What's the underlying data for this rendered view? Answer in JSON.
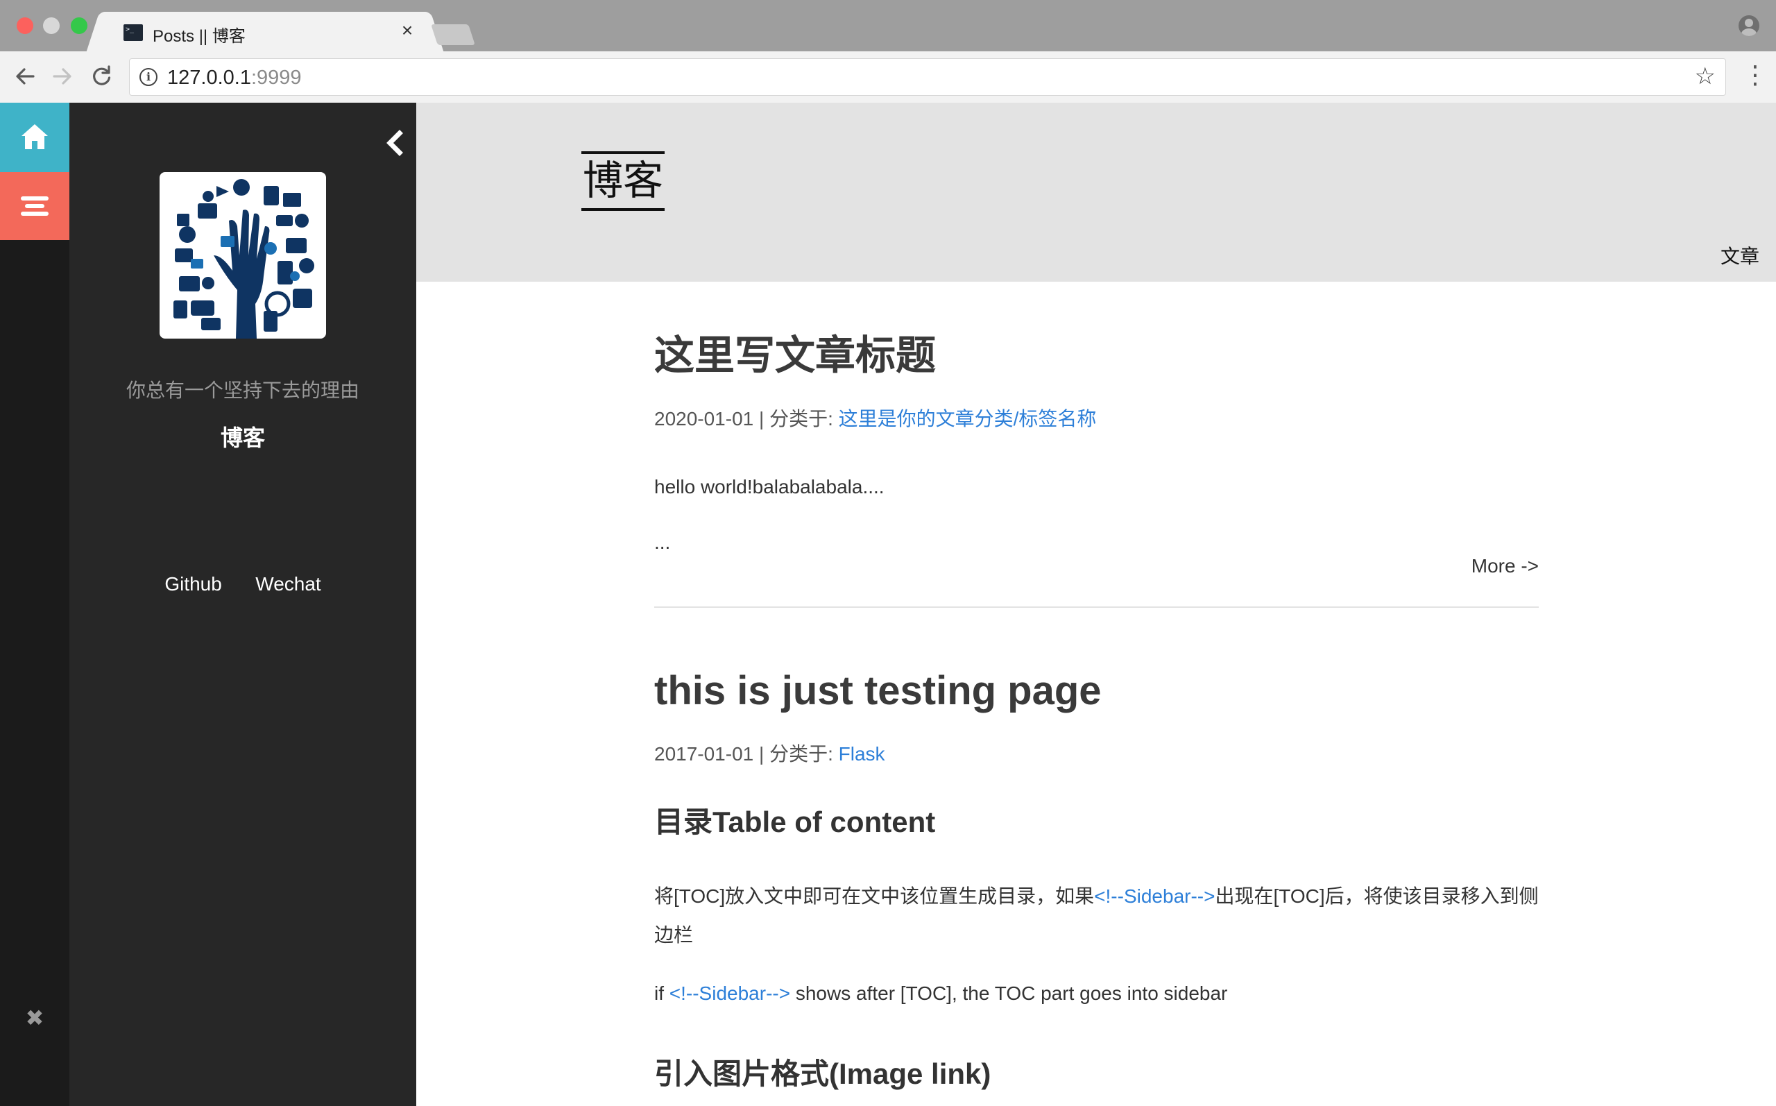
{
  "browser": {
    "tab_title": "Posts || 博客",
    "tab_close": "×",
    "url_host": "127.0.0.1",
    "url_port": ":9999",
    "icons": [
      "back-arrow-icon",
      "forward-arrow-icon",
      "reload-icon",
      "info-icon",
      "star-icon",
      "menu-dots-icon",
      "profile-icon"
    ]
  },
  "iconbar": {
    "colors": {
      "home": "#3fb3c8",
      "menu": "#f3695a"
    },
    "close_label": "✖"
  },
  "sidebar": {
    "motto": "你总有一个坚持下去的理由",
    "site_name": "博客",
    "links": [
      "Github",
      "Wechat"
    ]
  },
  "header": {
    "brand": "博客",
    "nav_item": "文章"
  },
  "posts": [
    {
      "title": "这里写文章标题",
      "date": "2020-01-01",
      "category_prefix": " | 分类于: ",
      "category": "这里是你的文章分类/标签名称",
      "excerpt": "hello world!balabalabala....",
      "ellipsis": "...",
      "more": "More ->"
    },
    {
      "title": "this is just testing page",
      "date": "2017-01-01",
      "category_prefix": " | 分类于: ",
      "category": "Flask",
      "heading1": "目录Table of content",
      "para1_before": "将[TOC]放入文中即可在文中该位置生成目录，如果",
      "para1_link": "<!--Sidebar-->",
      "para1_after": "出现在[TOC]后，将使该目录移入到侧边栏",
      "para2_before": "if ",
      "para2_link": "<!--Sidebar-->",
      "para2_after": " shows after [TOC], the TOC part goes into sidebar",
      "heading2": "引入图片格式(Image link)"
    }
  ]
}
